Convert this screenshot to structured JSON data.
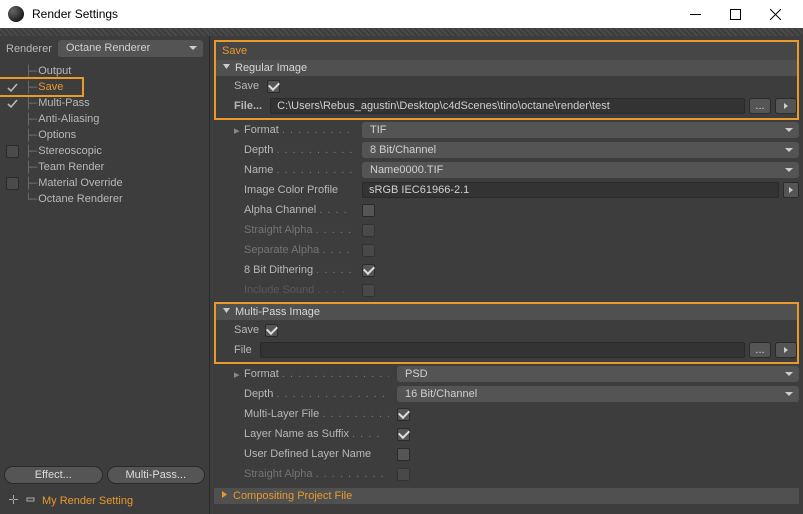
{
  "window": {
    "title": "Render Settings"
  },
  "renderer": {
    "label": "Renderer",
    "value": "Octane Renderer"
  },
  "sidebar_tree": [
    {
      "label": "Output",
      "check": null
    },
    {
      "label": "Save",
      "check": "tick",
      "selected": true
    },
    {
      "label": "Multi-Pass",
      "check": "tick"
    },
    {
      "label": "Anti-Aliasing",
      "check": null
    },
    {
      "label": "Options",
      "check": null
    },
    {
      "label": "Stereoscopic",
      "check": "box"
    },
    {
      "label": "Team Render",
      "check": null
    },
    {
      "label": "Material Override",
      "check": "box"
    },
    {
      "label": "Octane Renderer",
      "check": null
    }
  ],
  "sidebar_buttons": {
    "effect": "Effect...",
    "multipass": "Multi-Pass..."
  },
  "render_setting_name": "My Render Setting",
  "panel": {
    "title": "Save",
    "regular_image": {
      "title": "Regular Image",
      "save_label": "Save",
      "save_checked": true,
      "file_label": "File...",
      "file_value": "C:\\Users\\Rebus_agustin\\Desktop\\c4dScenes\\tino\\octane\\render\\test",
      "browse_label": "...",
      "format_label": "Format",
      "format_value": "TIF",
      "depth_label": "Depth",
      "depth_value": "8 Bit/Channel",
      "name_label": "Name",
      "name_value": "Name0000.TIF",
      "icp_label": "Image Color Profile",
      "icp_value": "sRGB IEC61966-2.1",
      "alpha_label": "Alpha Channel",
      "alpha_checked": false,
      "straight_alpha_label": "Straight Alpha",
      "separate_alpha_label": "Separate Alpha",
      "dither_label": "8 Bit Dithering",
      "dither_checked": true,
      "sound_label": "Include Sound"
    },
    "multipass_image": {
      "title": "Multi-Pass Image",
      "save_label": "Save",
      "save_checked": true,
      "file_label": "File",
      "file_value": "",
      "browse_label": "...",
      "format_label": "Format",
      "format_value": "PSD",
      "depth_label": "Depth",
      "depth_value": "16 Bit/Channel",
      "multilayer_label": "Multi-Layer File",
      "multilayer_checked": true,
      "layersuffix_label": "Layer Name as Suffix",
      "layersuffix_checked": true,
      "userlayer_label": "User Defined Layer Name",
      "userlayer_checked": false,
      "straight_alpha_label": "Straight Alpha"
    },
    "compositing": {
      "title": "Compositing Project File"
    }
  }
}
